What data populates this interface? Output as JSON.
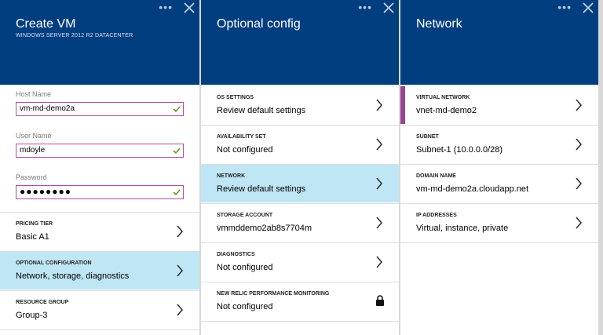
{
  "create_vm": {
    "title": "Create VM",
    "subtitle": "WINDOWS SERVER 2012 R2 DATACENTER",
    "fields": [
      {
        "label": "Host Name",
        "value": "vm-md-demo2a"
      },
      {
        "label": "User Name",
        "value": "mdoyle"
      },
      {
        "label": "Password",
        "value": "●●●●●●●●"
      }
    ],
    "rows": [
      {
        "label": "PRICING TIER",
        "value": "Basic A1"
      },
      {
        "label": "OPTIONAL CONFIGURATION",
        "value": "Network, storage, diagnostics"
      },
      {
        "label": "RESOURCE GROUP",
        "value": "Group-3"
      }
    ]
  },
  "optional_config": {
    "title": "Optional config",
    "rows": [
      {
        "label": "OS SETTINGS",
        "value": "Review default settings"
      },
      {
        "label": "AVAILABILITY SET",
        "value": "Not configured"
      },
      {
        "label": "NETWORK",
        "value": "Review default settings"
      },
      {
        "label": "STORAGE ACCOUNT",
        "value": "vmmddemo2ab8s7704m"
      },
      {
        "label": "DIAGNOSTICS",
        "value": "Not configured"
      },
      {
        "label": "NEW RELIC PERFORMANCE MONITORING",
        "value": "Not configured"
      }
    ]
  },
  "network": {
    "title": "Network",
    "rows": [
      {
        "label": "VIRTUAL NETWORK",
        "value": "vnet-md-demo2"
      },
      {
        "label": "SUBNET",
        "value": "Subnet-1 (10.0.0.0/28)"
      },
      {
        "label": "DOMAIN NAME",
        "value": "vm-md-demo2a.cloudapp.net"
      },
      {
        "label": "IP ADDRESSES",
        "value": "Virtual, instance, private"
      }
    ]
  },
  "icons": {
    "more": "ellipsis-icon",
    "close": "close-icon",
    "chevron": "chevron-right-icon",
    "check": "check-icon",
    "lock": "lock-icon"
  },
  "colors": {
    "header_bg": "#003e80",
    "selected_row_bg": "#bfe6f5",
    "valid_border": "#b14ca6",
    "check_green": "#5c9e1f",
    "accent_magenta": "#9b4294"
  },
  "ui": {
    "dots": "•••"
  }
}
